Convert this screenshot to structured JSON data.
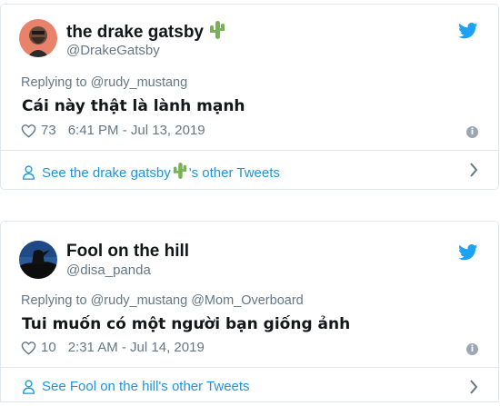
{
  "tweets": [
    {
      "display_name": "the drake gatsby",
      "name_emoji_icon": "cactus-icon",
      "handle": "@DrakeGatsby",
      "replying_prefix": "Replying to",
      "replying_to": "@rudy_mustang",
      "text": "Cái này thật là lành mạnh",
      "likes": "73",
      "timestamp": "6:41 PM - Jul 13, 2019",
      "other_prefix": "See the drake gatsby",
      "other_suffix": "'s other Tweets"
    },
    {
      "display_name": "Fool on the hill",
      "handle": "@disa_panda",
      "replying_prefix": "Replying to",
      "replying_to": "@rudy_mustang @Mom_Overboard",
      "text": "Tui muốn có một người bạn giống ảnh",
      "likes": "10",
      "timestamp": "2:31 AM - Jul 14, 2019",
      "other_label": "See Fool on the hill's other Tweets"
    }
  ],
  "colors": {
    "brand_blue": "#1b95e0",
    "twitter_bird": "#1da1f2",
    "muted_text": "#657786",
    "border": "#e1e8ed",
    "cactus_green": "#77b255"
  },
  "icons": [
    "twitter-bird-icon",
    "heart-icon",
    "info-icon",
    "person-icon",
    "chevron-right-icon",
    "cactus-icon"
  ]
}
